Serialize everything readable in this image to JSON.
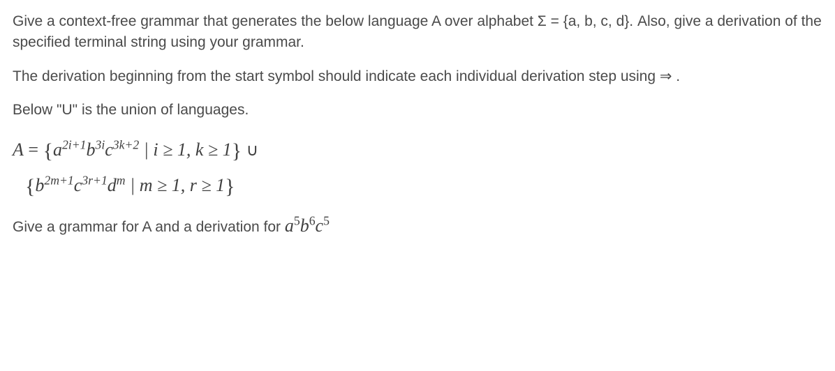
{
  "p1": "Give a context-free grammar that generates the below language A over alphabet  Σ = {a, b, c, d}. Also, give a derivation of the specified terminal string using your grammar.",
  "p2": "The derivation beginning from the start symbol should indicate each individual derivation step using ⇒ .",
  "p3": "Below \"U\" is the union of languages.",
  "eq_lhs": "A",
  "eq_eq": " = ",
  "set1": {
    "open": "{",
    "a_base": "a",
    "a_exp": "2i+1",
    "b_base": "b",
    "b_exp": "3i",
    "c_base": "c",
    "c_exp": "3k+2",
    "cond": " | i  ≥  1,  k ≥ 1",
    "close": "}"
  },
  "union": " ∪",
  "set2": {
    "open": "{",
    "b_base": "b",
    "b_exp": "2m+1",
    "c_base": "c",
    "c_exp": "3r+1",
    "d_base": "d",
    "d_exp": "m",
    "cond": " | m  ≥  1,  r ≥ 1",
    "close": "}"
  },
  "final_text": "Give a grammar for A and a derivation for ",
  "target": {
    "a_base": "a",
    "a_exp": "5",
    "b_base": "b",
    "b_exp": "6",
    "c_base": "c",
    "c_exp": "5"
  }
}
